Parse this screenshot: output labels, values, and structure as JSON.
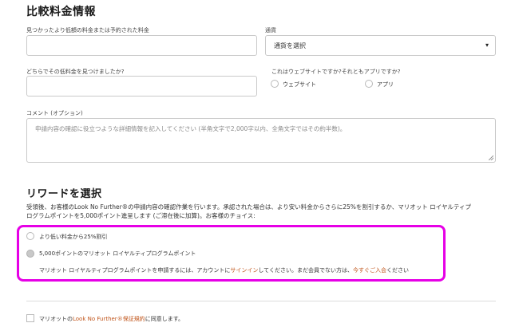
{
  "compare": {
    "title": "比較料金情報",
    "price_label": "見つかったより低額の料金または予約された料金",
    "price_value": "",
    "currency_label": "通貨",
    "currency_value": "通貨を選択",
    "where_label": "どちらでその低料金を見つけましたか?",
    "where_value": "",
    "site_or_app_label": "これはウェブサイトですか?それともアプリですか?",
    "option_website": "ウェブサイト",
    "option_app": "アプリ",
    "comment_label": "コメント (オプション)",
    "comment_placeholder": "申請内容の確認に役立つような詳細情報を記入してください (半角文字で2,000字以内、全角文字ではその約半数)。"
  },
  "reward": {
    "title": "リワードを選択",
    "desc_line1": "受領後、お客様のLook No Further®の申請内容の確認作業を行います。承認された場合は、より安い料金からさらに25%を割引するか、マリオット ロイヤルティプ",
    "desc_line2": "ログラムポイントを5,000ポイント進呈します (ご滞在後に加算)。お客様のチョイス:",
    "option_discount": "より低い料金から25%割引",
    "option_points": "5,000ポイントのマリオット ロイヤルティプログラムポイント",
    "signin_prefix": "マリオット ロイヤルティプログラムポイントを申請するには、アカウントに",
    "signin_link": "サインイン",
    "signin_middle": "してください。まだ会員でない方は、",
    "join_link": "今すぐご入会",
    "signin_suffix": "ください"
  },
  "terms": {
    "prefix": "マリオットの",
    "link": "Look No Further®保証規約",
    "suffix": "に同意します。"
  },
  "colors": {
    "highlight": "#e600e6",
    "link": "#c0541a"
  }
}
